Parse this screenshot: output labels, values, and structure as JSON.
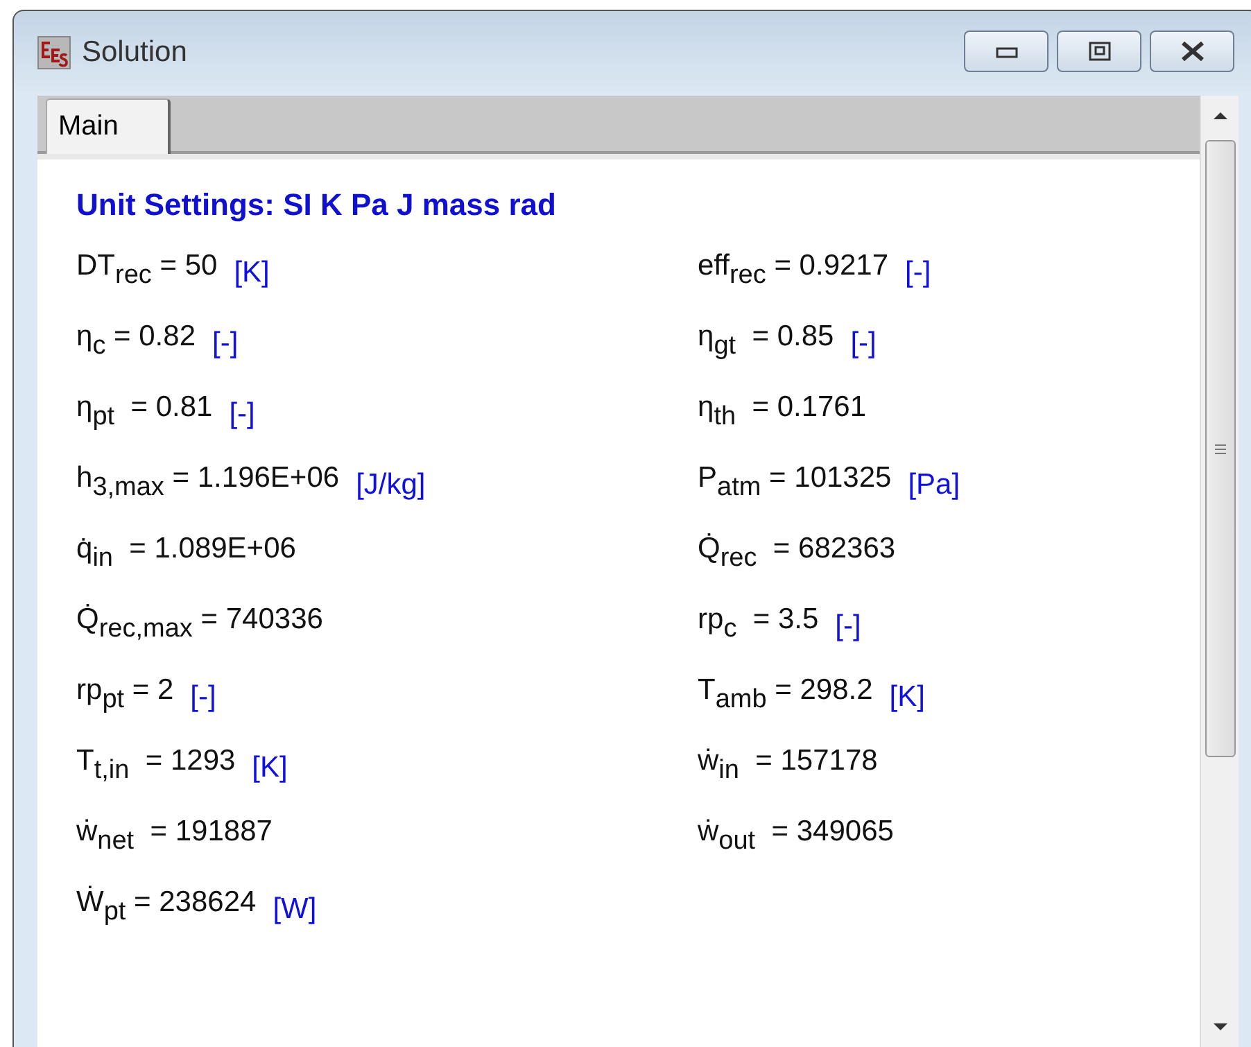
{
  "window": {
    "title": "Solution"
  },
  "tabs": [
    {
      "label": "Main",
      "selected": true
    }
  ],
  "heading": "Unit Settings: SI K Pa J mass rad",
  "columns": [
    [
      {
        "expression": "DT$_{rec}$ = 50",
        "unit": "[K]"
      },
      {
        "expression": "η$_{c}$ = 0.82",
        "unit": "[-]"
      },
      {
        "expression": "η$_{pt}$  = 0.81",
        "unit": "[-]"
      },
      {
        "expression": "h$_{3,max}$ = 1.196E+06",
        "unit": "[J/kg]"
      },
      {
        "expression": "q̇$_{in}$  = 1.089E+06"
      },
      {
        "expression": "Q̇$_{rec,max}$ = 740336"
      },
      {
        "expression": "rp$_{pt}$ = 2",
        "unit": "[-]"
      },
      {
        "expression": "T$_{t,in}$  = 1293",
        "unit": "[K]"
      },
      {
        "expression": "ẇ$_{net}$  = 191887"
      },
      {
        "expression": "Ẇ$_{pt}$ = 238624",
        "unit": "[W]"
      }
    ],
    [
      {
        "expression": "eff$_{rec}$ = 0.9217",
        "unit": "[-]"
      },
      {
        "expression": "η$_{gt}$  = 0.85",
        "unit": "[-]"
      },
      {
        "expression": "η$_{th}$  = 0.1761"
      },
      {
        "expression": "P$_{atm}$ = 101325",
        "unit": "[Pa]"
      },
      {
        "expression": "Q̇$_{rec}$  = 682363"
      },
      {
        "expression": "rp$_{c}$  = 3.5",
        "unit": "[-]"
      },
      {
        "expression": "T$_{amb}$ = 298.2",
        "unit": "[K]"
      },
      {
        "expression": "ẇ$_{in}$  = 157178"
      },
      {
        "expression": "ẇ$_{out}$  = 349065"
      }
    ]
  ]
}
